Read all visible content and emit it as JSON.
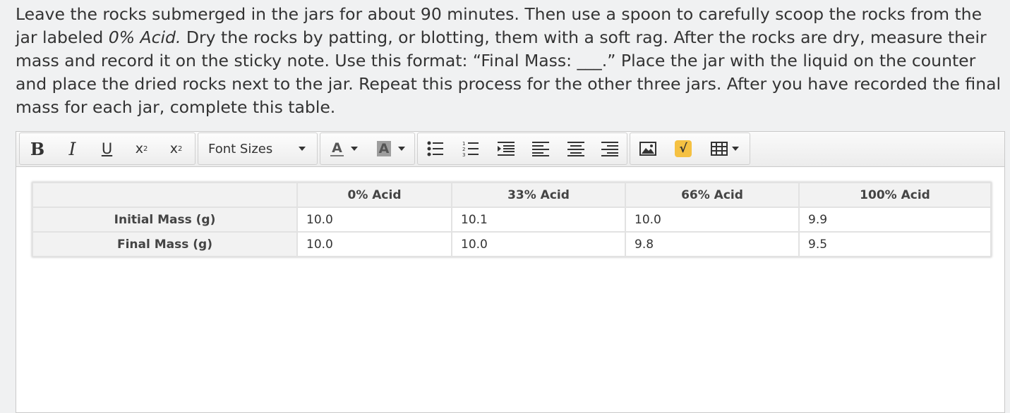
{
  "instructions": {
    "part1": "Leave the rocks submerged in the jars for about 90 minutes. Then use a spoon to carefully scoop the rocks from the jar labeled ",
    "part1_italic": "0% Acid.",
    "part2": " Dry the rocks by patting, or blotting, them with a soft rag. After the rocks are dry, measure their mass and record it on the sticky note. Use this format: “Final Mass: ___.” Place the jar with the liquid on the counter and place the dried rocks next to the jar. Repeat this process for the other three jars. After you have recorded the final mass for each jar, complete this table."
  },
  "toolbar": {
    "bold": "B",
    "italic": "I",
    "underline": "U",
    "superscript": "x",
    "superscript_mark": "2",
    "subscript": "x",
    "subscript_mark": "2",
    "font_sizes": "Font Sizes",
    "text_color": "A",
    "bg_color": "A",
    "math_symbol": "√",
    "accent_color": "#f5c142"
  },
  "table": {
    "headers": [
      "",
      "0% Acid",
      "33% Acid",
      "66% Acid",
      "100% Acid"
    ],
    "rows": [
      {
        "label": "Initial Mass (g)",
        "cells": [
          "10.0",
          "10.1",
          "10.0",
          "9.9"
        ]
      },
      {
        "label": "Final Mass (g)",
        "cells": [
          "10.0",
          "10.0",
          "9.8",
          "9.5"
        ]
      }
    ]
  }
}
